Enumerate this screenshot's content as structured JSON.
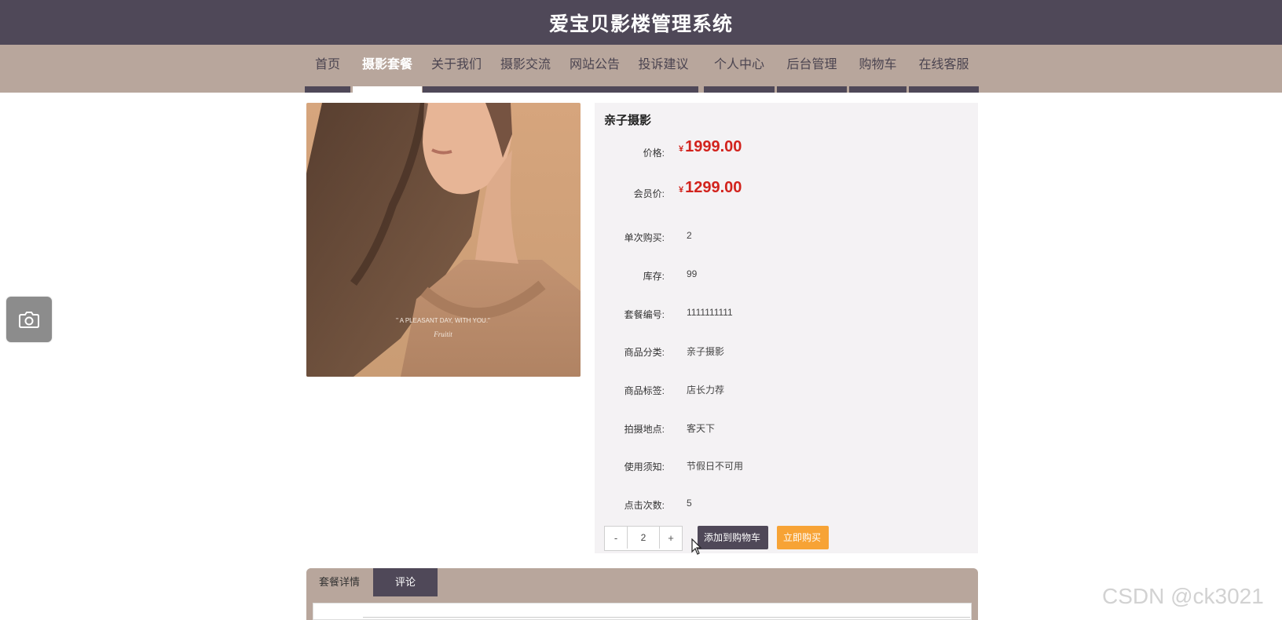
{
  "header": {
    "title": "爱宝贝影楼管理系统"
  },
  "nav": {
    "items": [
      {
        "label": "首页"
      },
      {
        "label": "摄影套餐"
      },
      {
        "label": "关于我们"
      },
      {
        "label": "摄影交流"
      },
      {
        "label": "网站公告"
      },
      {
        "label": "投诉建议"
      },
      {
        "label": "个人中心"
      },
      {
        "label": "后台管理"
      },
      {
        "label": "购物车"
      },
      {
        "label": "在线客服"
      }
    ],
    "active": "摄影套餐"
  },
  "product": {
    "image_caption": "\" A PLEASANT DAY, WITH YOU.\"",
    "image_signature": "Fruitit",
    "name": "亲子摄影",
    "currency": "¥",
    "price_label": "价格:",
    "price": "1999.00",
    "member_price_label": "会员价:",
    "member_price": "1299.00",
    "fields": [
      {
        "label": "单次购买:",
        "value": "2"
      },
      {
        "label": "库存:",
        "value": "99"
      },
      {
        "label": "套餐编号:",
        "value": "1111111111"
      },
      {
        "label": "商品分类:",
        "value": "亲子摄影"
      },
      {
        "label": "商品标签:",
        "value": "店长力荐"
      },
      {
        "label": "拍摄地点:",
        "value": "客天下"
      },
      {
        "label": "使用须知:",
        "value": "节假日不可用"
      },
      {
        "label": "点击次数:",
        "value": "5"
      }
    ]
  },
  "quantity": {
    "minus": "-",
    "value": "2",
    "plus": "+"
  },
  "actions": {
    "add_to_cart": "添加到购物车",
    "buy_now": "立即购买"
  },
  "tabs": [
    {
      "label": "套餐详情"
    },
    {
      "label": "评论"
    }
  ],
  "active_tab": "评论",
  "float_button": {
    "icon": "camera-icon"
  },
  "watermark": "CSDN @ck3021",
  "colors": {
    "header": "#4f4858",
    "nav": "#b8a69c",
    "price": "#d2231d",
    "buy_button": "#f7a335",
    "cart_button": "#4f4858"
  }
}
